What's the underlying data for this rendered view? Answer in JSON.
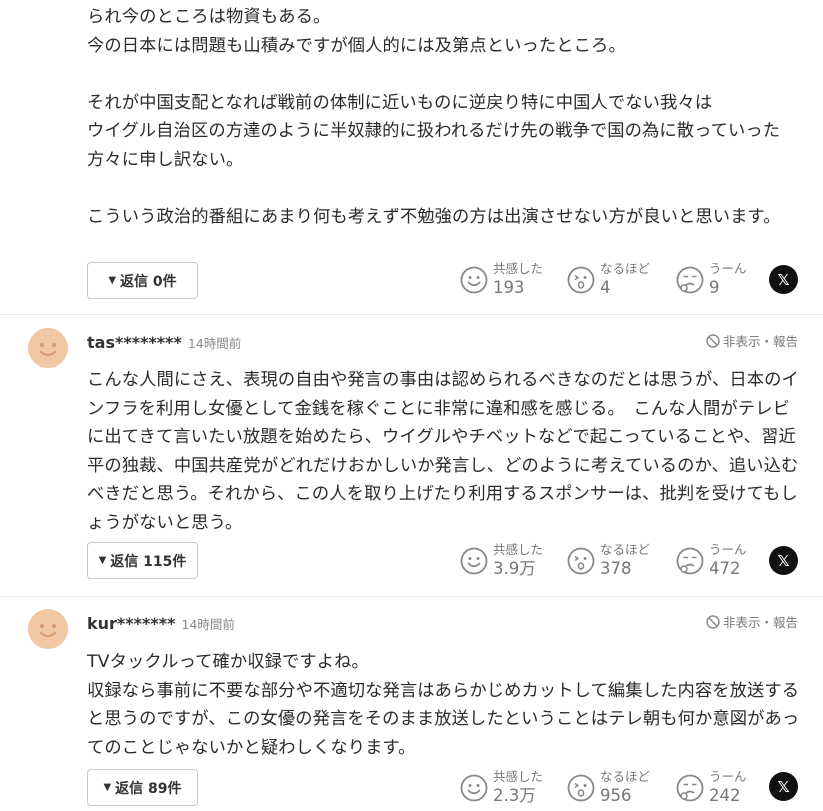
{
  "comments": [
    {
      "text": "られ今のところは物資もある。\n今の日本には問題も山積みですが個人的には及第点といったところ。\n\nそれが中国支配となれば戦前の体制に近いものに逆戻り特に中国人でない我々は\nウイグル自治区の方達のように半奴隷的に扱われるだけ先の戦争で国の為に散っていった方々に申し訳ない。\n\nこういう政治的番組にあまり何も考えず不勉強の方は出演させない方が良いと思います。",
      "reply_label": "返信 0件",
      "empathy_label": "共感した",
      "empathy_count": "193",
      "naruhodo_label": "なるほど",
      "naruhodo_count": "4",
      "uun_label": "うーん",
      "uun_count": "9"
    },
    {
      "user": "tas********",
      "time": "14時間前",
      "report": "非表示・報告",
      "text": "こんな人間にさえ、表現の自由や発言の事由は認められるべきなのだとは思うが、日本のインフラを利用し女優として金銭を稼ぐことに非常に違和感を感じる。　こんな人間がテレビに出てきて言いたい放題を始めたら、ウイグルやチベットなどで起こっていることや、習近平の独裁、中国共産党がどれだけおかしいか発言し、どのように考えているのか、追い込むべきだと思う。それから、この人を取り上げたり利用するスポンサーは、批判を受けてもしょうがないと思う。",
      "reply_label": "返信 115件",
      "empathy_label": "共感した",
      "empathy_count": "3.9万",
      "naruhodo_label": "なるほど",
      "naruhodo_count": "378",
      "uun_label": "うーん",
      "uun_count": "472"
    },
    {
      "user": "kur*******",
      "time": "14時間前",
      "report": "非表示・報告",
      "text": "TVタックルって確か収録ですよね。\n収録なら事前に不要な部分や不適切な発言はあらかじめカットして編集した内容を放送すると思うのですが、この女優の発言をそのまま放送したということはテレ朝も何か意図があってのことじゃないかと疑わしくなります。",
      "reply_label": "返信 89件",
      "empathy_label": "共感した",
      "empathy_count": "2.3万",
      "naruhodo_label": "なるほど",
      "naruhodo_count": "956",
      "uun_label": "うーん",
      "uun_count": "242"
    }
  ],
  "x_button": "𝕏",
  "icons": {
    "avatar": "smiley-avatar-icon",
    "empathy": "smile-face-icon",
    "naruhodo": "surprised-face-icon",
    "uun": "thinking-face-icon",
    "hide": "prohibited-icon"
  },
  "colors": {
    "avatar_bg": "#f2c7a3",
    "avatar_face": "#d9986a",
    "icon_gray": "#888888"
  }
}
